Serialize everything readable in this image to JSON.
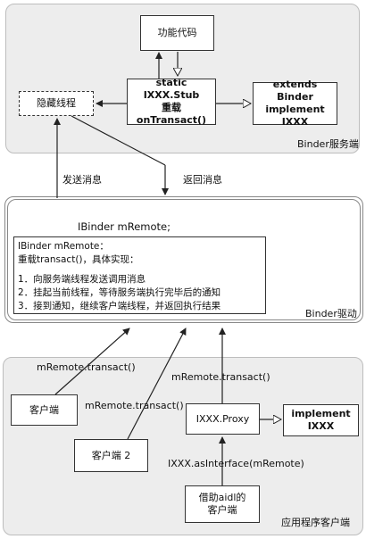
{
  "server": {
    "caption": "Binder服务端",
    "function_code": "功能代码",
    "hidden_thread": "隐藏线程",
    "stub_line1": "static IXXX.Stub",
    "stub_line2": "重载onTransact()",
    "extends_line1": "extends Binder",
    "extends_line2": "implement IXXX"
  },
  "middle_labels": {
    "send": "发送消息",
    "return": "返回消息"
  },
  "driver": {
    "caption": "Binder驱动",
    "ibinder": "IBinder mRemote;",
    "note": {
      "line1": "IBinder mRemote：",
      "line2": "重载transact()，具体实现：",
      "steps": [
        "1．向服务端线程发送调用消息",
        "2．挂起当前线程，等待服务端执行完毕后的通知",
        "3．接到通知，继续客户端线程，并返回执行结果"
      ]
    }
  },
  "client": {
    "caption": "应用程序客户端",
    "client1": "客户端",
    "client2": "客户端 2",
    "transact1": "mRemote.transact()",
    "transact2": "mRemote.transact()",
    "transact3": "mRemote.transact()",
    "proxy": "IXXX.Proxy",
    "implement_line1": "implement",
    "implement_line2": "IXXX",
    "as_interface": "IXXX.asInterface(mRemote)",
    "aidl_line1": "借助aidl的",
    "aidl_line2": "客户端"
  }
}
